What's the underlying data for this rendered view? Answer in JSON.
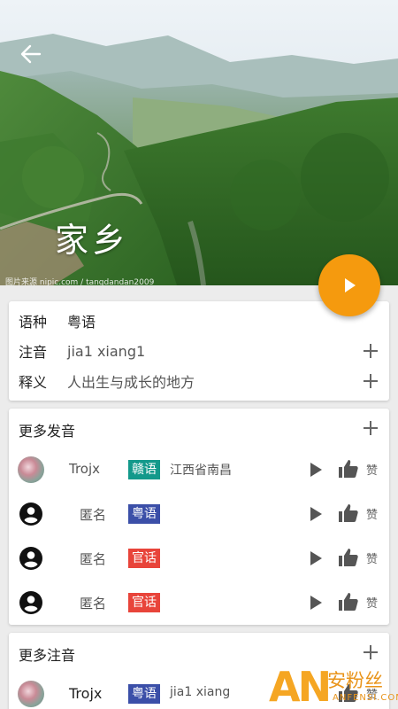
{
  "hero": {
    "title": "家乡",
    "watermark": "图片来源 nipic.com / tangdandan2009"
  },
  "info": {
    "dialect_label": "语种",
    "dialect_value": "粤语",
    "phonetic_label": "注音",
    "phonetic_value": "jia1 xiang1",
    "meaning_label": "释义",
    "meaning_value": "人出生与成长的地方"
  },
  "more_pronunciations": {
    "title": "更多发音",
    "items": [
      {
        "user": "Trojx",
        "tag": "赣语",
        "tag_color": "#13998b",
        "region": "江西省南昌",
        "like": "赞"
      },
      {
        "user": "匿名",
        "tag": "粤语",
        "tag_color": "#3b4fa8",
        "region": "",
        "like": "赞"
      },
      {
        "user": "匿名",
        "tag": "官话",
        "tag_color": "#e8443a",
        "region": "",
        "like": "赞"
      },
      {
        "user": "匿名",
        "tag": "官话",
        "tag_color": "#e8443a",
        "region": "",
        "like": "赞"
      }
    ]
  },
  "more_phonetics": {
    "title": "更多注音",
    "items": [
      {
        "user": "Trojx",
        "tag": "粤语",
        "tag_color": "#3b4fa8",
        "phonetic": "jia1 xiang",
        "like": "赞"
      }
    ]
  },
  "brand": {
    "mark": "AN",
    "name_cn": "安粉丝",
    "name_en": "ANFENSI.COM",
    "color": "#f5a623"
  },
  "colors": {
    "accent": "#f59a0e",
    "tag_teal": "#13998b",
    "tag_blue": "#3b4fa8",
    "tag_red": "#e8443a"
  }
}
